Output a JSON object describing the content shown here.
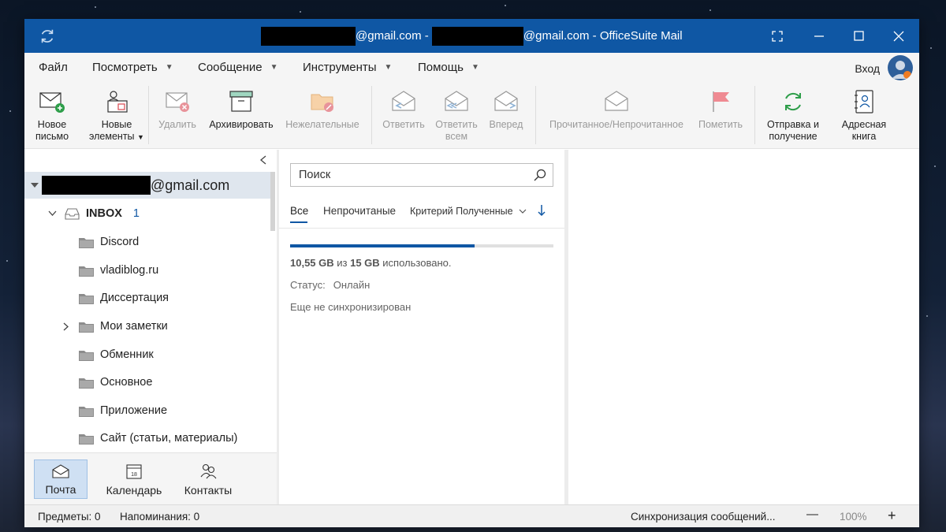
{
  "window": {
    "title_domain1": "@gmail.com",
    "title_separator": " - ",
    "title_domain2": "@gmail.com",
    "title_app": " - OfficeSuite Mail",
    "accent": "#0f57a4"
  },
  "menu": {
    "file": "Файл",
    "view": "Посмотреть",
    "message": "Сообщение",
    "tools": "Инструменты",
    "help": "Помощь",
    "login": "Вход"
  },
  "ribbon": {
    "new_mail": [
      "Новое",
      "письмо"
    ],
    "new_items": [
      "Новые",
      "элементы"
    ],
    "delete": "Удалить",
    "archive": "Архивировать",
    "junk": "Нежелательные",
    "reply": "Ответить",
    "reply_all": [
      "Ответить",
      "всем"
    ],
    "forward": "Вперед",
    "read_unread": "Прочитанное/Непрочитанное",
    "flag": "Пометить",
    "send_receive": [
      "Отправка и",
      "получение"
    ],
    "address_book": [
      "Адресная",
      "книга"
    ]
  },
  "sidebar": {
    "account_email": "@gmail.com",
    "inbox": "INBOX",
    "inbox_count": "1",
    "folders": [
      "Discord",
      "vladiblog.ru",
      "Диссертация",
      "Мои заметки",
      "Обменник",
      "Основное",
      "Приложение",
      "Сайт (статьи, материалы)"
    ]
  },
  "nav": {
    "mail": "Почта",
    "calendar": "Календарь",
    "contacts": "Контакты",
    "calendar_day": "18"
  },
  "list": {
    "search_placeholder": "Поиск",
    "filter_all": "Все",
    "filter_unread": "Непрочитаные",
    "sort": "Критерий Полученные",
    "usage_used": "10,55 GB",
    "usage_of": " из ",
    "usage_total": "15 GB",
    "usage_suffix": " использовано.",
    "usage_fraction": 0.7,
    "status_label": "Статус:",
    "status_value": "Онлайн",
    "sync_text": "Еще не синхронизирован"
  },
  "statusbar": {
    "items": "Предметы: 0",
    "reminders": "Напоминания: 0",
    "sync": "Синхронизация сообщений...",
    "zoom": "100%",
    "zoom_out": "—",
    "zoom_in": "+"
  }
}
